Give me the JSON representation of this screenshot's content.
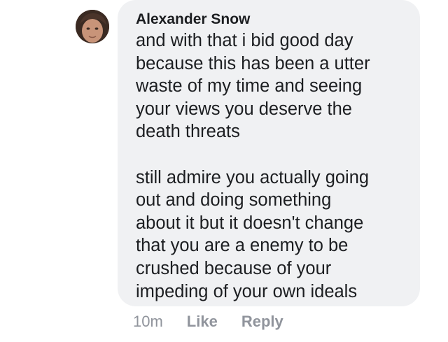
{
  "comment": {
    "author": "Alexander Snow",
    "lines_p1": [
      "and with that i bid good day",
      "because this has been a utter",
      "waste of my time and seeing",
      "your views you deserve the",
      "death threats"
    ],
    "lines_p2": [
      "still admire you actually going",
      "out and doing something",
      "about it but it doesn't change",
      "that you are a enemy to be",
      "crushed because of your",
      "impeding of your own ideals"
    ],
    "timestamp": "10m",
    "like_label": "Like",
    "reply_label": "Reply"
  },
  "colors": {
    "bubble_bg": "#f0f1f3",
    "text": "#1c1e21",
    "meta": "#90949c"
  }
}
